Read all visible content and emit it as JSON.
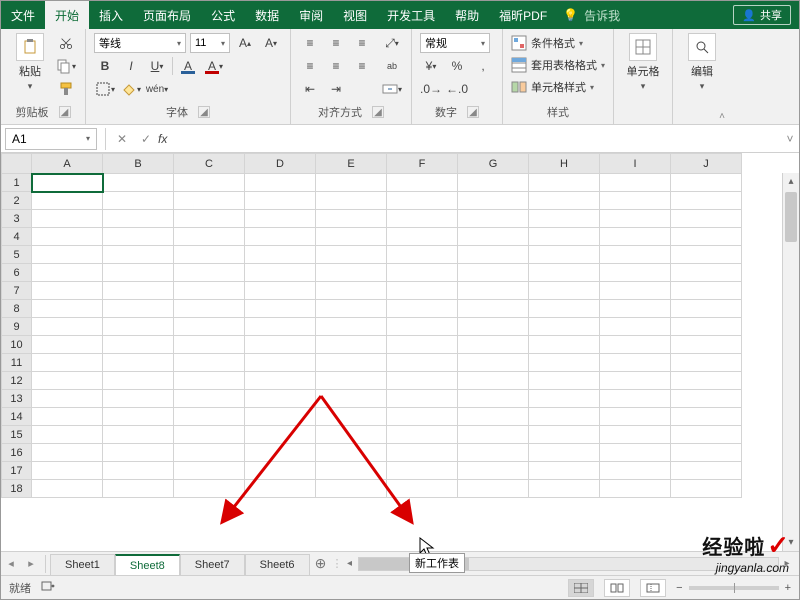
{
  "menu": {
    "tabs": [
      "文件",
      "开始",
      "插入",
      "页面布局",
      "公式",
      "数据",
      "审阅",
      "视图",
      "开发工具",
      "帮助",
      "福昕PDF"
    ],
    "active_index": 1,
    "tell_me": "告诉我",
    "share": "共享"
  },
  "ribbon": {
    "clipboard": {
      "paste": "粘贴",
      "label": "剪贴板"
    },
    "font": {
      "label": "字体",
      "name": "等线",
      "size": "11",
      "bold": "B",
      "italic": "I",
      "underline": "U",
      "pinyin": "wén"
    },
    "alignment": {
      "label": "对齐方式",
      "wrap": "ab"
    },
    "number": {
      "label": "数字",
      "format": "常规"
    },
    "styles": {
      "label": "样式",
      "cond_fmt": "条件格式",
      "table_fmt": "套用表格格式",
      "cell_styles": "单元格样式"
    },
    "cells": {
      "label": "单元格"
    },
    "editing": {
      "label": "编辑"
    }
  },
  "formula_bar": {
    "name_box": "A1",
    "fx": "fx",
    "value": ""
  },
  "grid": {
    "columns": [
      "A",
      "B",
      "C",
      "D",
      "E",
      "F",
      "G",
      "H",
      "I",
      "J"
    ],
    "rows": [
      1,
      2,
      3,
      4,
      5,
      6,
      7,
      8,
      9,
      10,
      11,
      12,
      13,
      14,
      15,
      16,
      17,
      18
    ],
    "active_cell": "A1"
  },
  "sheet_tabs": {
    "tabs": [
      "Sheet1",
      "Sheet8",
      "Sheet7",
      "Sheet6"
    ],
    "active_index": 1,
    "new_sheet_tooltip": "新工作表"
  },
  "status_bar": {
    "ready": "就绪",
    "zoom": ""
  },
  "watermark": {
    "brand": "经验啦",
    "url": "jingyanla.com"
  }
}
